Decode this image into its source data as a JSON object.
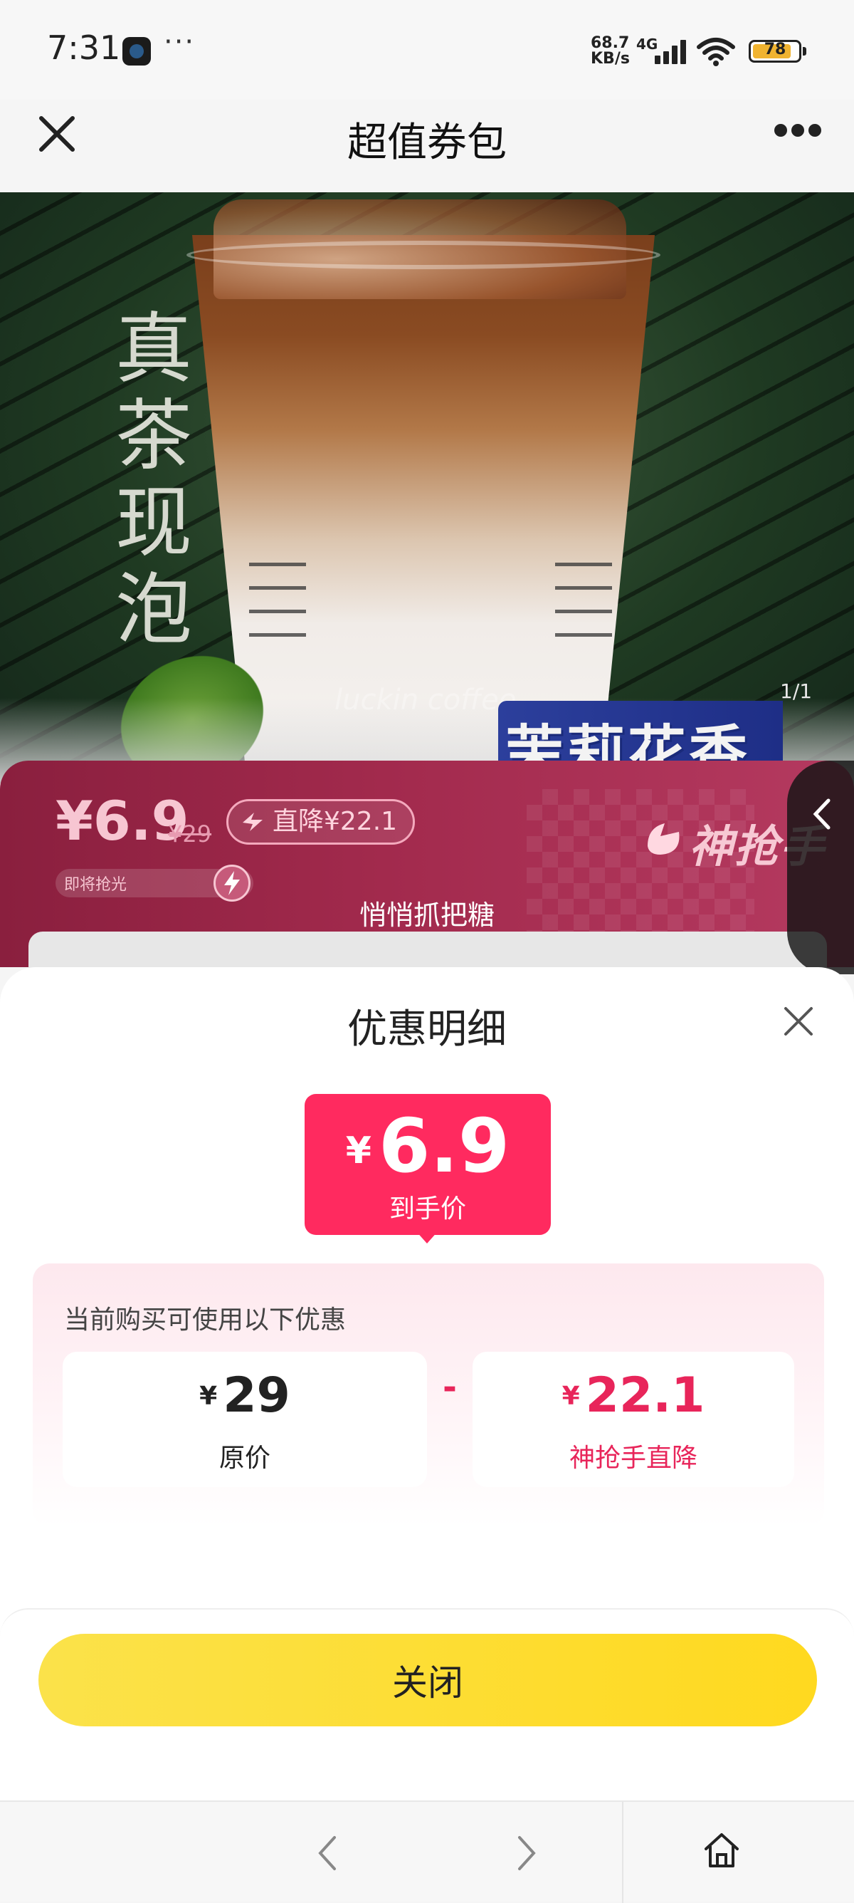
{
  "status_bar": {
    "time": "7:31",
    "more": "···",
    "net_speed_value": "68.7",
    "net_speed_unit": "KB/s",
    "network_type": "4G",
    "battery_level": "78"
  },
  "navbar": {
    "title": "超值券包"
  },
  "hero": {
    "vertical_text": "真茶现泡",
    "pager": "1/1",
    "tag_text": "茉莉花香",
    "cup_text": "luckin coffee"
  },
  "promo": {
    "price": "¥6.9",
    "original_price": "¥29",
    "discount_badge": "直降¥22.1",
    "brand": "神抢手",
    "stock_text": "即将抢光",
    "slogan": "悄悄抓把糖"
  },
  "sheet": {
    "title": "优惠明细",
    "final_price": {
      "symbol": "¥",
      "amount": "6.9",
      "label": "到手价"
    },
    "discount_heading": "当前购买可使用以下优惠",
    "original": {
      "symbol": "¥",
      "amount": "29",
      "label": "原价"
    },
    "operator": "-",
    "reduction": {
      "symbol": "¥",
      "amount": "22.1",
      "label": "神抢手直降"
    },
    "close_button": "关闭"
  },
  "colors": {
    "accent_pink": "#ff2a5f",
    "reduction_text": "#e8255a",
    "button_yellow": "#ffd91f",
    "promo_band": "#a22a4d"
  },
  "icons": {
    "navbar_close": "close-icon",
    "navbar_more": "more-icon",
    "sheet_close": "close-icon",
    "back": "chevron-left-icon",
    "forward": "chevron-right-icon",
    "home": "home-icon"
  }
}
